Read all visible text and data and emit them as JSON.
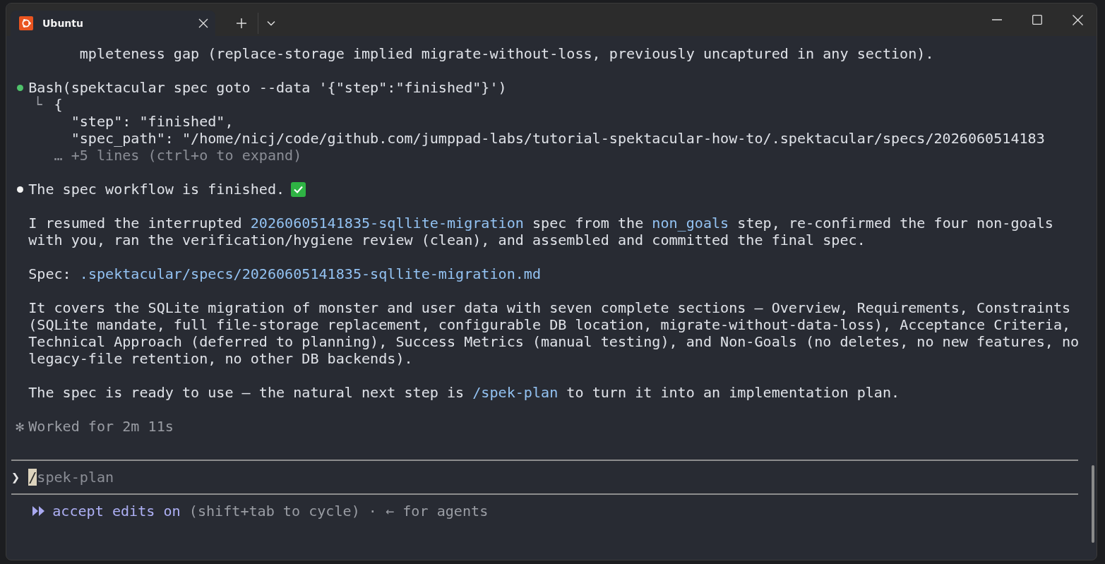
{
  "window": {
    "tab_title": "Ubuntu"
  },
  "transcript": [
    {
      "kind": "continuation",
      "text": "mpleteness gap (replace-storage implied migrate-without-loss, previously uncaptured in any section)."
    },
    {
      "kind": "tool_call",
      "text": "Bash(spektacular spec goto --data '{\"step\":\"finished\"}')",
      "result": {
        "branch": "└",
        "open": "{",
        "fields": [
          "\"step\": \"finished\",",
          "\"spec_path\": \"/home/nicj/code/github.com/jumppad-labs/tutorial-spektacular-how-to/.spektacular/specs/2026060514183"
        ],
        "more": "… +5 lines (ctrl+o to expand)"
      }
    },
    {
      "kind": "message",
      "text": "The spec workflow is finished.",
      "done": true
    },
    {
      "kind": "paragraph",
      "lines": [
        [
          {
            "kind": "plain",
            "text": "I resumed the interrupted "
          },
          {
            "kind": "link",
            "text": "20260605141835-sqllite-migration"
          },
          {
            "kind": "plain",
            "text": " spec from the "
          },
          {
            "kind": "link",
            "text": "non_goals"
          },
          {
            "kind": "plain",
            "text": " step, re-confirmed the four non-goals"
          }
        ],
        [
          {
            "kind": "plain",
            "text": "with you, ran the verification/hygiene review (clean), and assembled and committed the final spec."
          }
        ]
      ]
    },
    {
      "kind": "paragraph",
      "lines": [
        [
          {
            "kind": "plain",
            "text": "Spec: "
          },
          {
            "kind": "link",
            "text": ".spektacular/specs/20260605141835-sqllite-migration.md"
          }
        ]
      ]
    },
    {
      "kind": "paragraph",
      "lines": [
        [
          {
            "kind": "plain",
            "text": "It covers the SQLite migration of monster and user data with seven complete sections — Overview, Requirements, Constraints"
          }
        ],
        [
          {
            "kind": "plain",
            "text": "(SQLite mandate, full file-storage replacement, configurable DB location, migrate-without-data-loss), Acceptance Criteria,"
          }
        ],
        [
          {
            "kind": "plain",
            "text": "Technical Approach (deferred to planning), Success Metrics (manual testing), and Non-Goals (no deletes, no new features, no"
          }
        ],
        [
          {
            "kind": "plain",
            "text": "legacy-file retention, no other DB backends)."
          }
        ]
      ]
    },
    {
      "kind": "paragraph",
      "lines": [
        [
          {
            "kind": "plain",
            "text": "The spec is ready to use — the natural next step is "
          },
          {
            "kind": "link",
            "text": "/spek-plan"
          },
          {
            "kind": "plain",
            "text": " to turn it into an implementation plan."
          }
        ]
      ]
    },
    {
      "kind": "status",
      "symbol": "✻",
      "text": "Worked for 2m 11s"
    }
  ],
  "prompt": {
    "symbol": "❯",
    "typed": "/",
    "suggestion": "spek-plan"
  },
  "mode_line": {
    "mode": "accept edits on",
    "hint": "(shift+tab to cycle)",
    "separator": "·",
    "arrow": "←",
    "extra": "for agents"
  }
}
